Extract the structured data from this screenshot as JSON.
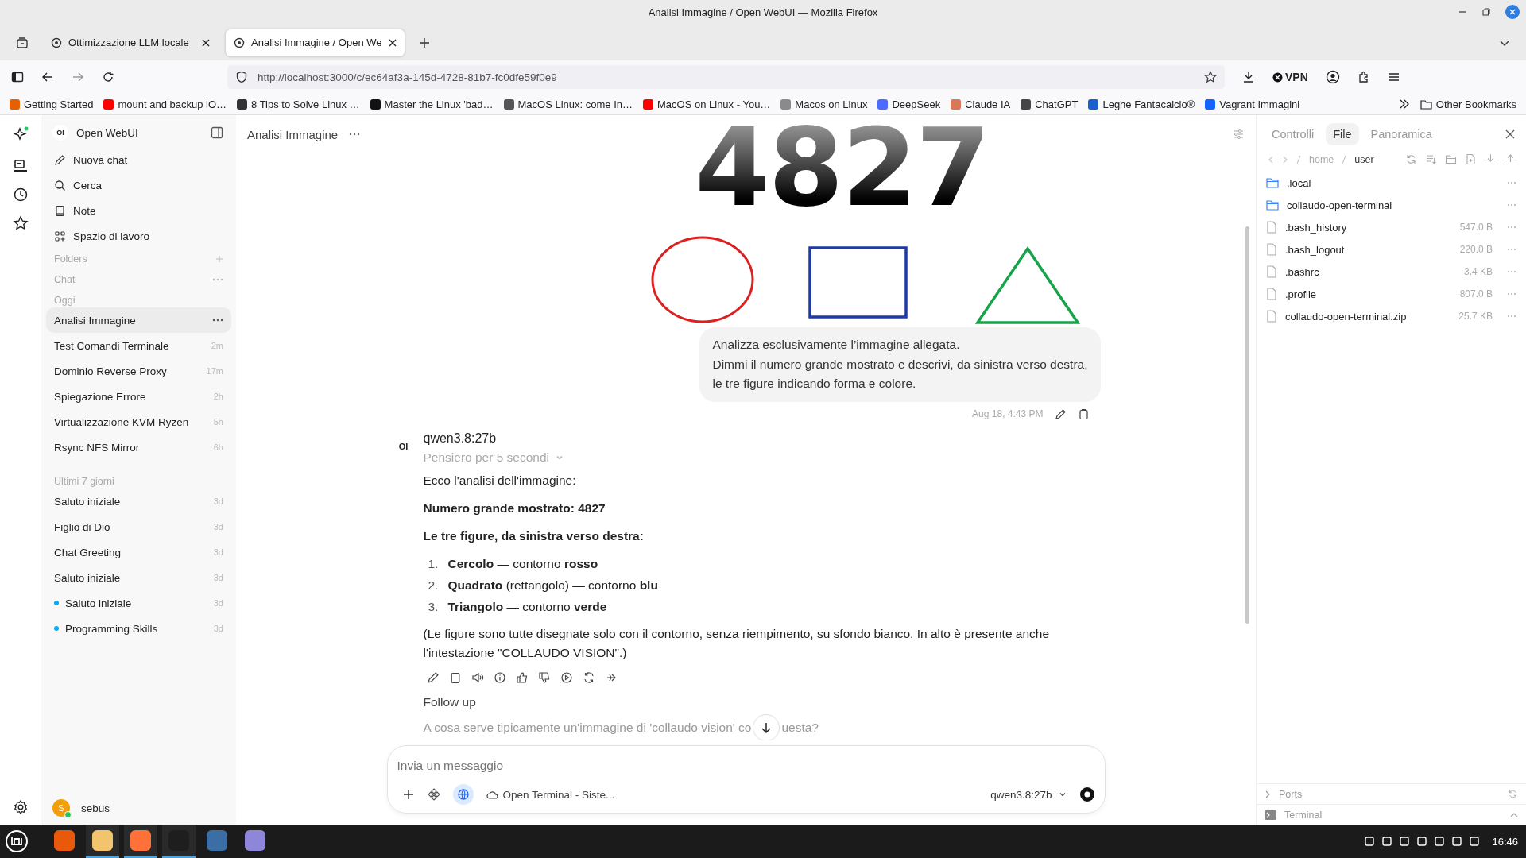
{
  "window": {
    "title": "Analisi Immagine / Open WebUI — Mozilla Firefox"
  },
  "browser_tabs": [
    {
      "label": "Ottimizzazione LLM locale",
      "selected": false
    },
    {
      "label": "Analisi Immagine / Open We",
      "selected": true
    }
  ],
  "address_bar": {
    "url": "http://localhost:3000/c/ec64af3a-145d-4728-81b7-fc0dfe59f0e9"
  },
  "vpn_label": "VPN",
  "bookmarks": [
    {
      "label": "Getting Started",
      "color": "#e66000"
    },
    {
      "label": "mount and backup iO…",
      "color": "#ff0000"
    },
    {
      "label": "8 Tips to Solve Linux …",
      "color": "#333333"
    },
    {
      "label": "Master the Linux 'bad…",
      "color": "#111111"
    },
    {
      "label": "MacOS Linux: come In…",
      "color": "#555555"
    },
    {
      "label": "MacOS on Linux - You…",
      "color": "#ff0000"
    },
    {
      "label": "Macos on Linux",
      "color": "#8a8a8a"
    },
    {
      "label": "DeepSeek",
      "color": "#4d6bfe"
    },
    {
      "label": "Claude IA",
      "color": "#d97757"
    },
    {
      "label": "ChatGPT",
      "color": "#444444"
    },
    {
      "label": "Leghe Fantacalcio®",
      "color": "#1a5fd0"
    },
    {
      "label": "Vagrant Immagini",
      "color": "#1563ff"
    }
  ],
  "other_bookmarks": "Other Bookmarks",
  "sidebar": {
    "logo": "OI",
    "app_name": "Open WebUI",
    "nav": [
      {
        "kind": "new",
        "label": "Nuova chat"
      },
      {
        "kind": "search",
        "label": "Cerca"
      },
      {
        "kind": "notes",
        "label": "Note"
      },
      {
        "kind": "workspace",
        "label": "Spazio di lavoro"
      }
    ],
    "folders_label": "Folders",
    "chat_label": "Chat",
    "groups": [
      {
        "label": "Oggi",
        "chats": [
          {
            "title": "Analisi Immagine",
            "selected": true,
            "unread": false
          },
          {
            "title": "Test Comandi Terminale",
            "time": "2m",
            "selected": false,
            "unread": false
          },
          {
            "title": "Dominio Reverse Proxy",
            "time": "17m",
            "selected": false,
            "unread": false
          },
          {
            "title": "Spiegazione Errore",
            "time": "2h",
            "selected": false,
            "unread": false
          },
          {
            "title": "Virtualizzazione KVM Ryzen",
            "time": "5h",
            "selected": false,
            "unread": false
          },
          {
            "title": "Rsync NFS Mirror",
            "time": "6h",
            "selected": false,
            "unread": false
          }
        ]
      },
      {
        "label": "Ultimi 7 giorni",
        "chats": [
          {
            "title": "Saluto iniziale",
            "time": "3d",
            "selected": false,
            "unread": false
          },
          {
            "title": "Figlio di Dio",
            "time": "3d",
            "selected": false,
            "unread": false
          },
          {
            "title": "Chat Greeting",
            "time": "3d",
            "selected": false,
            "unread": false
          },
          {
            "title": "Saluto iniziale",
            "time": "3d",
            "selected": false,
            "unread": false
          },
          {
            "title": "Saluto iniziale",
            "time": "3d",
            "selected": false,
            "unread": true
          },
          {
            "title": "Programming Skills",
            "time": "3d",
            "selected": false,
            "unread": true
          }
        ]
      }
    ],
    "user": {
      "initial": "S",
      "name": "sebus"
    }
  },
  "chat": {
    "title": "Analisi Immagine",
    "attached_image": {
      "number": "4827"
    },
    "user_message": {
      "lines": [
        "Analizza esclusivamente l’immagine allegata.",
        "Dimmi il numero grande mostrato e descrivi, da sinistra verso destra,",
        "le tre figure indicando forma e colore."
      ],
      "timestamp": "Aug 18, 4:43 PM"
    },
    "assistant": {
      "avatar": "OI",
      "model": "qwen3.8:27b",
      "thinking": "Pensiero per 5 secondi",
      "blocks": [
        {
          "kind": "paragraph",
          "text": "Ecco l'analisi dell'immagine:"
        },
        {
          "kind": "heading",
          "text": "Numero grande mostrato: 4827"
        },
        {
          "kind": "heading",
          "text": "Le tre figure, da sinistra verso destra:"
        },
        {
          "kind": "list",
          "items": [
            {
              "number": "1.",
              "text": "**Cercolo** — contorno **rosso**"
            },
            {
              "number": "2.",
              "text": "**Quadrato** (rettangolo) — contorno **blu**"
            },
            {
              "number": "3.",
              "text": "**Triangolo** — contorno **verde**"
            }
          ]
        },
        {
          "kind": "paragraph",
          "text": "(Le figure sono tutte disegnate solo con il contorno, senza riempimento, su sfondo bianco. In alto è presente anche l'intestazione \"COLLAUDO VISION\".)"
        }
      ]
    },
    "follow_up": {
      "label": "Follow up",
      "suggestion_before": "A cosa serve tipicamente un'immagine di 'collaudo vision' co",
      "suggestion_after": "uesta?"
    },
    "input": {
      "placeholder": "Invia un messaggio",
      "web_search": true,
      "tool": "Open Terminal - Siste...",
      "model": "qwen3.8:27b"
    }
  },
  "files_panel": {
    "tabs": [
      {
        "label": "Controlli",
        "selected": false
      },
      {
        "label": "File",
        "selected": true
      },
      {
        "label": "Panoramica",
        "selected": false
      }
    ],
    "path": [
      "home",
      "user"
    ],
    "entries": [
      {
        "kind": "folder",
        "name": ".local"
      },
      {
        "kind": "folder",
        "name": "collaudo-open-terminal"
      },
      {
        "kind": "file",
        "name": ".bash_history",
        "size": "547.0 B"
      },
      {
        "kind": "file",
        "name": ".bash_logout",
        "size": "220.0 B"
      },
      {
        "kind": "file",
        "name": ".bashrc",
        "size": "3.4 KB"
      },
      {
        "kind": "file",
        "name": ".profile",
        "size": "807.0 B"
      },
      {
        "kind": "file",
        "name": "collaudo-open-terminal.zip",
        "size": "25.7 KB"
      }
    ],
    "ports_label": "Ports",
    "terminal_label": "Terminal"
  },
  "taskbar": {
    "apps": [
      {
        "kind": "media",
        "running": false
      },
      {
        "kind": "files",
        "running": true
      },
      {
        "kind": "firefox",
        "running": true
      },
      {
        "kind": "terminal",
        "running": true
      },
      {
        "kind": "camera",
        "running": false
      },
      {
        "kind": "notes",
        "running": false
      }
    ],
    "clock": "16:46"
  }
}
